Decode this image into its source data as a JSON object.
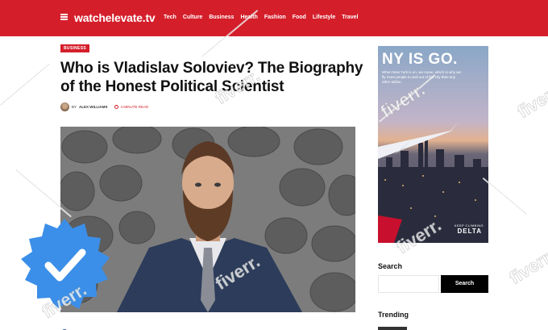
{
  "header": {
    "logo": "watchelevate.tv",
    "nav": [
      "Tech",
      "Culture",
      "Business",
      "Health",
      "Fashion",
      "Food",
      "Lifestyle",
      "Travel"
    ]
  },
  "article": {
    "category": "BUSINESS",
    "title": "Who is Vladislav Soloviev? The Biography of the Honest Political Scientist",
    "by": "BY",
    "author": "ALEX WILLIAMS",
    "read_time": "4 MINUTE READ"
  },
  "sidebar": {
    "ad": {
      "headline": "NY IS GO.",
      "copy": "When New York is on, we move, which is why we fly more people to and out of the city than any other airline.",
      "tagline": "KEEP CLIMBING",
      "brand": "DELTA"
    },
    "search_heading": "Search",
    "search_placeholder": "",
    "search_button": "Search",
    "trending_heading": "Trending"
  },
  "watermark": "fiverr.",
  "colors": {
    "brand_red": "#d41f2b",
    "badge_blue": "#3b8fe8"
  },
  "icons": [
    "menu-icon",
    "clock-icon",
    "verified-check-icon",
    "facebook-icon"
  ]
}
